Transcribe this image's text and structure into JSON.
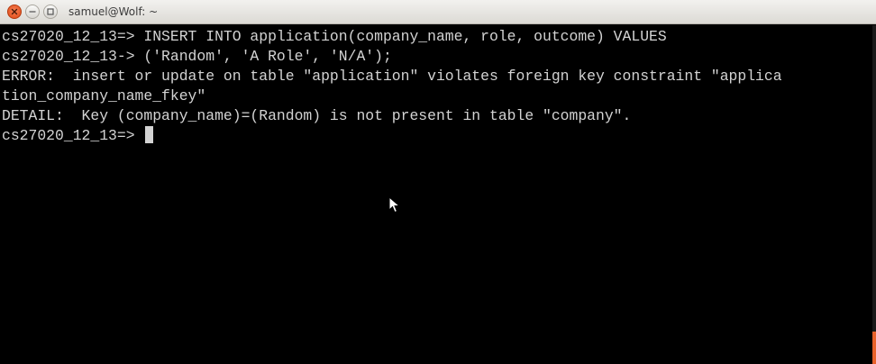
{
  "window": {
    "title": "samuel@Wolf: ~"
  },
  "terminal": {
    "lines": [
      "cs27020_12_13=> INSERT INTO application(company_name, role, outcome) VALUES",
      "cs27020_12_13-> ('Random', 'A Role', 'N/A');",
      "ERROR:  insert or update on table \"application\" violates foreign key constraint \"applica",
      "tion_company_name_fkey\"",
      "DETAIL:  Key (company_name)=(Random) is not present in table \"company\".",
      "cs27020_12_13=> "
    ]
  },
  "colors": {
    "background": "#000000",
    "text": "#d3d3d3",
    "close_button": "#df4a16",
    "scroll_thumb": "#e8622b"
  },
  "icons": [
    "close-icon",
    "minimize-icon",
    "maximize-icon",
    "mouse-pointer-icon"
  ]
}
